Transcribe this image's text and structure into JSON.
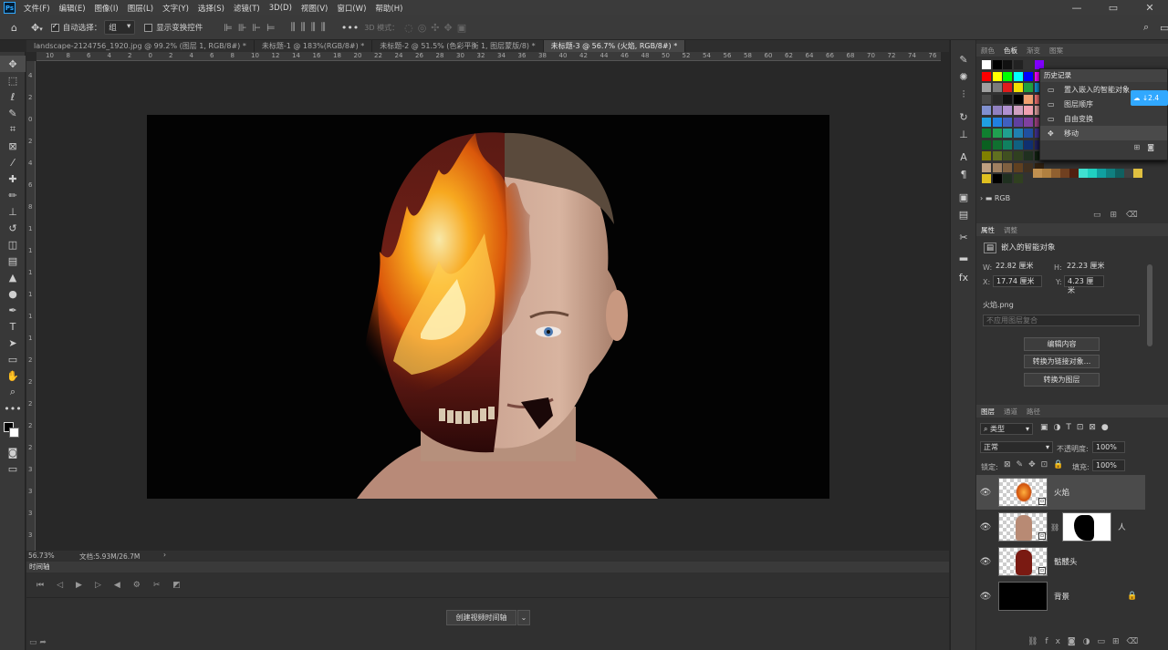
{
  "menu": {
    "logo": "Ps",
    "items": [
      "文件(F)",
      "编辑(E)",
      "图像(I)",
      "图层(L)",
      "文字(Y)",
      "选择(S)",
      "滤镜(T)",
      "3D(D)",
      "视图(V)",
      "窗口(W)",
      "帮助(H)"
    ]
  },
  "window_controls": {
    "minimize": "—",
    "restore": "▭",
    "close": "✕"
  },
  "options": {
    "auto_select_label": "自动选择：",
    "auto_select_value": "组",
    "show_transform_label": "显示变换控件",
    "mode_3d_label": "3D 模式："
  },
  "tabs": [
    {
      "label": "landscape-2124756_1920.jpg @ 99.2% (图层 1, RGB/8#) *",
      "active": false
    },
    {
      "label": "未标题-1 @ 183%(RGB/8#) *",
      "active": false
    },
    {
      "label": "未标题-2 @ 51.5% (色彩平衡 1, 图层蒙版/8) *",
      "active": false
    },
    {
      "label": "未标题-3 @ 56.7% (火焰, RGB/8#) *",
      "active": true
    }
  ],
  "ruler_h": [
    "10",
    "8",
    "6",
    "4",
    "2",
    "0",
    "2",
    "4",
    "6",
    "8",
    "10",
    "12",
    "14",
    "16",
    "18",
    "20",
    "22",
    "24",
    "26",
    "28",
    "30",
    "32",
    "34",
    "36",
    "38",
    "40",
    "42",
    "44",
    "46",
    "48",
    "50",
    "52",
    "54",
    "56",
    "58",
    "60",
    "62",
    "64",
    "66",
    "68",
    "70",
    "72",
    "74",
    "76"
  ],
  "ruler_v": [
    "4",
    "2",
    "0",
    "2",
    "4",
    "6",
    "8",
    "1",
    "1",
    "1",
    "1",
    "1",
    "1",
    "2",
    "2",
    "2",
    "2",
    "2",
    "3",
    "3",
    "3",
    "3"
  ],
  "status": {
    "zoom": "56.73%",
    "doc": "文档:5.93M/26.7M"
  },
  "timeline": {
    "title": "时间轴",
    "create_button": "创建视频时间轴"
  },
  "swatches_panel": {
    "tabs": [
      "颜色",
      "色板",
      "渐变",
      "图案"
    ],
    "active": "色板",
    "group": "RGB"
  },
  "swatch_colors": {
    "row1": [
      "#ffffff",
      "#000000",
      "#111111",
      "#222222",
      "#333333",
      "#8000ff"
    ],
    "row2": [
      "#ff0000",
      "#ffff00",
      "#00ff00",
      "#00ffff",
      "#0000ff",
      "#ff00ff"
    ],
    "row3": [
      "#a0a0a0",
      "#7b7b7b",
      "#e01b1b",
      "#f2e000",
      "#20a040",
      "#1090d0"
    ],
    "row4": [
      "#4a4a4a",
      "#2a2a2a",
      "#111111",
      "#000000",
      "#f0a070",
      "#f07070"
    ],
    "row5": [
      "#8090d0",
      "#9080c0",
      "#b090d0",
      "#d0a0c0",
      "#f0a0b0",
      "#e0a0a0"
    ],
    "row6": [
      "#20a0e0",
      "#2080e0",
      "#4060c0",
      "#6040a0",
      "#8040a0",
      "#a04080"
    ],
    "row7": [
      "#108030",
      "#20a050",
      "#20a090",
      "#2080b0",
      "#2050a0",
      "#403090"
    ],
    "row8": [
      "#0a6020",
      "#107030",
      "#108060",
      "#106080",
      "#103070",
      "#202060"
    ],
    "row9": [
      "#808000",
      "#607020",
      "#405020",
      "#304020",
      "#203020",
      "#102010"
    ],
    "row10": [
      "#c0a080",
      "#a08060",
      "#806040",
      "#604020",
      "#403020",
      "#302010"
    ],
    "row11": [
      "#e0c020",
      "#000000",
      "#203020",
      "#304020"
    ],
    "tail": [
      "#c09050",
      "#b08040",
      "#906030",
      "#704020",
      "#502010",
      "#40e0d0",
      "#20d0c0",
      "#10a0a0",
      "#108080",
      "#106060",
      "#404040",
      "#e0c040"
    ]
  },
  "history": {
    "title": "历史记录",
    "items": [
      {
        "label": "置入嵌入的智能对象",
        "selected": false
      },
      {
        "label": "图层顺序",
        "selected": false
      },
      {
        "label": "自由变换",
        "selected": false
      },
      {
        "label": "移动",
        "selected": true
      }
    ]
  },
  "cloud_badge": {
    "text": "↓2.4"
  },
  "properties": {
    "tabs": [
      "属性",
      "调整"
    ],
    "type": "嵌入的智能对象",
    "w_label": "W:",
    "w_value": "22.82 厘米",
    "h_label": "H:",
    "h_value": "22.23 厘米",
    "x_label": "X:",
    "x_value": "17.74 厘米",
    "y_label": "Y:",
    "y_value": "4.23 厘米",
    "file": "火焰.png",
    "comp": "不应用图层复合",
    "btn_edit": "编辑内容",
    "btn_convert_linked": "转换为链接对象...",
    "btn_convert_layer": "转换为图层"
  },
  "layers_panel": {
    "tabs": [
      "图层",
      "通道",
      "路径"
    ],
    "filter": "类型",
    "blend": "正常",
    "opacity_label": "不透明度:",
    "opacity": "100%",
    "lock_label": "锁定:",
    "fill_label": "填充:",
    "fill": "100%",
    "layers": [
      {
        "name": "火焰",
        "active": true
      },
      {
        "name": "人",
        "active": false
      },
      {
        "name": "骷髅头",
        "active": false
      },
      {
        "name": "背景",
        "active": false
      }
    ]
  }
}
